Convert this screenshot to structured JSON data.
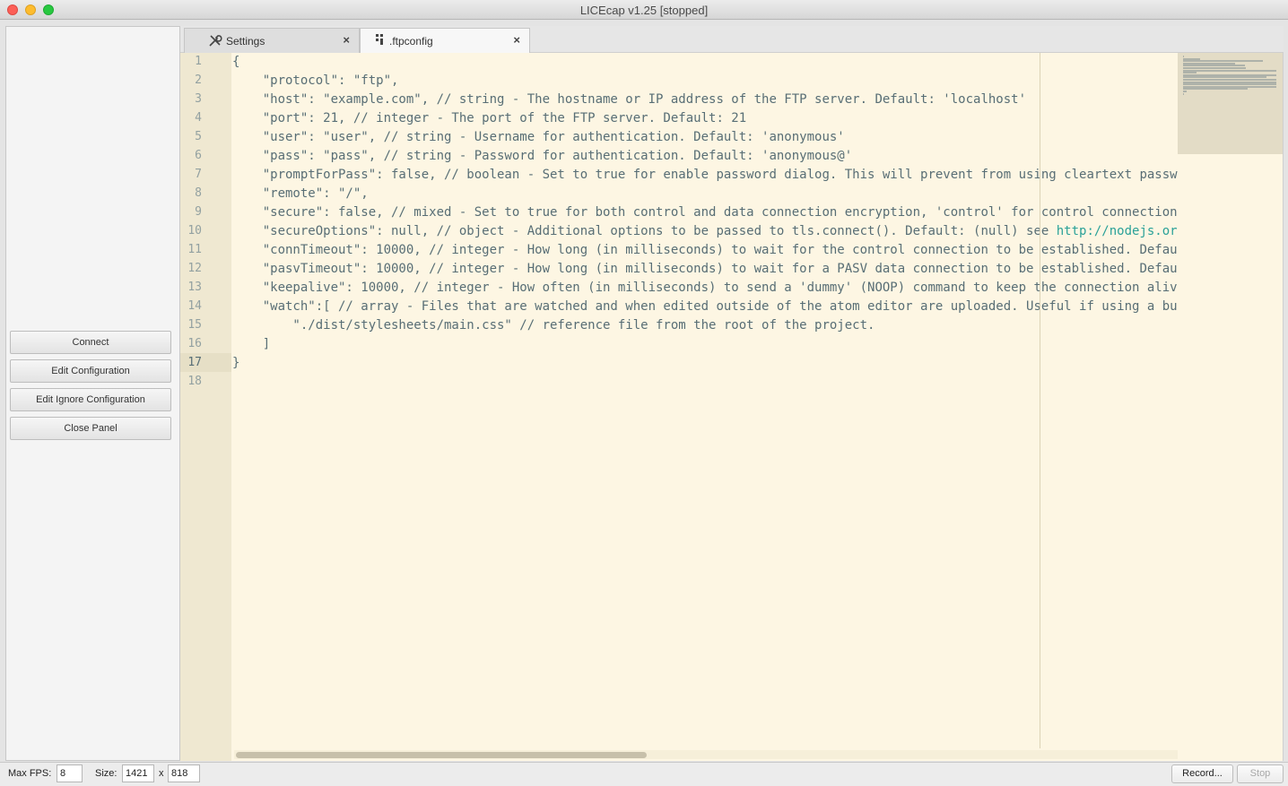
{
  "window": {
    "title": "LICEcap v1.25 [stopped]"
  },
  "panel": {
    "buttons": [
      "Connect",
      "Edit Configuration",
      "Edit Ignore Configuration",
      "Close Panel"
    ]
  },
  "tabs": [
    {
      "label": "Settings",
      "icon": "wrench-icon",
      "close": "×"
    },
    {
      "label": ".ftpconfig",
      "icon": "file-config-icon",
      "close": "×"
    }
  ],
  "editor": {
    "active_line": 17,
    "line_numbers": [
      "1",
      "2",
      "3",
      "4",
      "5",
      "6",
      "7",
      "8",
      "9",
      "10",
      "11",
      "12",
      "13",
      "14",
      "15",
      "16",
      "17",
      "18"
    ],
    "lines": [
      "{",
      "    \"protocol\": \"ftp\",",
      "    \"host\": \"example.com\", // string - The hostname or IP address of the FTP server. Default: 'localhost'",
      "    \"port\": 21, // integer - The port of the FTP server. Default: 21",
      "    \"user\": \"user\", // string - Username for authentication. Default: 'anonymous'",
      "    \"pass\": \"pass\", // string - Password for authentication. Default: 'anonymous@'",
      "    \"promptForPass\": false, // boolean - Set to true for enable password dialog. This will prevent from using cleartext passw",
      "    \"remote\": \"/\",",
      "    \"secure\": false, // mixed - Set to true for both control and data connection encryption, 'control' for control connection",
      "    \"secureOptions\": null, // object - Additional options to be passed to tls.connect(). Default: (null) see ",
      "    \"connTimeout\": 10000, // integer - How long (in milliseconds) to wait for the control connection to be established. Defau",
      "    \"pasvTimeout\": 10000, // integer - How long (in milliseconds) to wait for a PASV data connection to be established. Defau",
      "    \"keepalive\": 10000, // integer - How often (in milliseconds) to send a 'dummy' (NOOP) command to keep the connection aliv",
      "    \"watch\":[ // array - Files that are watched and when edited outside of the atom editor are uploaded. Useful if using a bu",
      "        \"./dist/stylesheets/main.css\" // reference file from the root of the project.",
      "    ]",
      "}",
      ""
    ],
    "line10_url": "http://nodejs.or"
  },
  "bottombar": {
    "fps_label": "Max FPS:",
    "fps_value": "8",
    "size_label": "Size:",
    "width_value": "1421",
    "x_label": "x",
    "height_value": "818",
    "record_label": "Record...",
    "stop_label": "Stop"
  }
}
